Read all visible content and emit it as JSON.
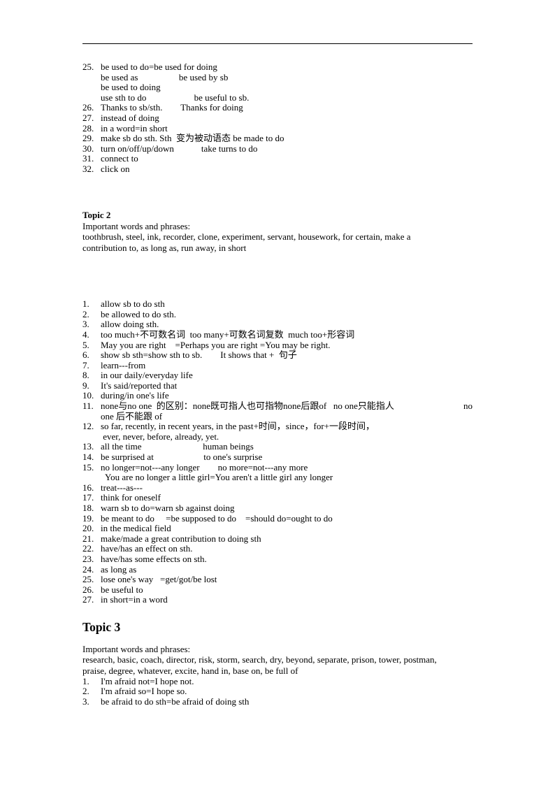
{
  "document": {
    "topic1_continued": {
      "items": [
        {
          "num": "25.",
          "text": "be used to do=be used for doing",
          "sublines": [
            "be used as                  be used by sb",
            "be used to doing",
            "use sth to do                     be useful to sb."
          ]
        },
        {
          "num": "26.",
          "text": "Thanks to sb/sth.        Thanks for doing",
          "sublines": []
        },
        {
          "num": "27.",
          "text": "instead of doing",
          "sublines": []
        },
        {
          "num": "28.",
          "text": "in a word=in short",
          "sublines": []
        },
        {
          "num": "29.",
          "text": "make sb do sth. Sth  变为被动语态 be made to do",
          "sublines": []
        },
        {
          "num": "30.",
          "text": "turn on/off/up/down            take turns to do",
          "sublines": []
        },
        {
          "num": "31.",
          "text": "connect to",
          "sublines": []
        },
        {
          "num": "32.",
          "text": "click on",
          "sublines": []
        }
      ]
    },
    "topic2": {
      "heading": "Topic 2",
      "words_label": "Important words and phrases:",
      "words_line1": " toothbrush, steel, ink, recorder, clone, experiment, servant, housework, for certain, make a",
      "words_line2": "contribution to, as long as, run away, in short",
      "items": [
        {
          "num": "1.",
          "text": "allow sb to do sth",
          "sublines": []
        },
        {
          "num": "2.",
          "text": "be allowed to do sth.",
          "sublines": []
        },
        {
          "num": "3.",
          "text": "allow doing sth.",
          "sublines": []
        },
        {
          "num": "4.",
          "text": "too much+不可数名词  too many+可数名词复数  much too+形容词",
          "sublines": []
        },
        {
          "num": "5.",
          "text": "May you are right    =Perhaps you are right =You may be right.",
          "sublines": []
        },
        {
          "num": "6.",
          "text": "show sb sth=show sth to sb.        It shows that +  句子",
          "sublines": []
        },
        {
          "num": "7.",
          "text": "learn---from",
          "sublines": []
        },
        {
          "num": "8.",
          "text": "in our daily/everyday life",
          "sublines": []
        },
        {
          "num": "9.",
          "text": "It's said/reported that",
          "sublines": []
        },
        {
          "num": "10.",
          "text": "during/in one's life",
          "sublines": []
        },
        {
          "num": "11.",
          "text_left": "none与no one  的区别：none既可指人也可指物none后跟of   no one只能指人",
          "text_right": "no",
          "is_split": true,
          "sublines": [
            "one 后不能跟 of"
          ]
        },
        {
          "num": "12.",
          "text": "so far, recently, in recent years, in the past+时间，since，for+一段时间，",
          "sublines": [
            " ever, never, before, already, yet."
          ]
        },
        {
          "num": "13.",
          "text": "all the time                           human beings",
          "sublines": []
        },
        {
          "num": "14.",
          "text": "be surprised at                      to one's surprise",
          "sublines": []
        },
        {
          "num": "15.",
          "text": "no longer=not---any longer        no more=not---any more",
          "sublines": [
            "  You are no longer a little girl=You aren't a little girl any longer"
          ]
        },
        {
          "num": "16.",
          "text": "treat---as---",
          "sublines": []
        },
        {
          "num": "17.",
          "text": "think for oneself",
          "sublines": []
        },
        {
          "num": "18.",
          "text": "warn sb to do=warn sb against doing",
          "sublines": []
        },
        {
          "num": "19.",
          "text": "be meant to do     =be supposed to do    =should do=ought to do",
          "sublines": []
        },
        {
          "num": "20.",
          "text": "in the medical field",
          "sublines": []
        },
        {
          "num": "21.",
          "text": "make/made a great contribution to doing sth",
          "sublines": []
        },
        {
          "num": "22.",
          "text": "have/has an effect on sth.",
          "sublines": []
        },
        {
          "num": "23.",
          "text": "have/has some effects on sth.",
          "sublines": []
        },
        {
          "num": "24.",
          "text": "as long as",
          "sublines": []
        },
        {
          "num": "25.",
          "text": "lose one's way   =get/got/be lost",
          "sublines": []
        },
        {
          "num": "26.",
          "text": "be useful to",
          "sublines": []
        },
        {
          "num": "27.",
          "text": "in short=in a word",
          "sublines": []
        }
      ]
    },
    "topic3": {
      "heading": "Topic 3",
      "words_label": "Important words and phrases:",
      "words_line1": "research, basic, coach, director, risk, storm, search, dry, beyond, separate, prison, tower, postman,",
      "words_line2": "praise, degree, whatever, excite, hand in, base on, be full of",
      "items": [
        {
          "num": "1.",
          "text": "I'm afraid not=I hope not.",
          "sublines": []
        },
        {
          "num": "2.",
          "text": "I'm afraid so=I hope so.",
          "sublines": []
        },
        {
          "num": "3.",
          "text": "be afraid to do sth=be afraid of doing sth",
          "sublines": []
        }
      ]
    }
  }
}
